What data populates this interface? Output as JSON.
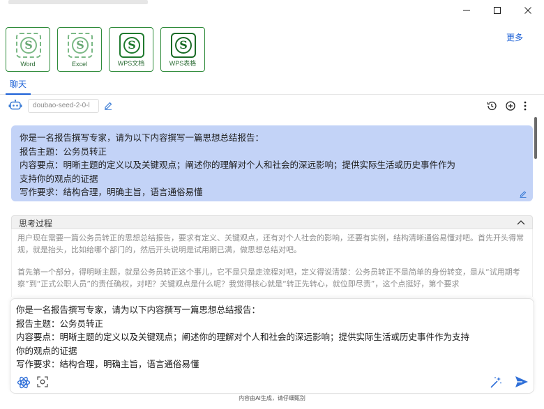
{
  "window": {
    "controls": {
      "minimize_icon": "minimize-icon",
      "maximize_icon": "maximize-icon",
      "close_icon": "close-icon"
    }
  },
  "apps": {
    "tiles": [
      {
        "label": "Word",
        "glyph": "S"
      },
      {
        "label": "Excel",
        "glyph": "S"
      },
      {
        "label": "WPS文档",
        "glyph": "S"
      },
      {
        "label": "WPS表格",
        "glyph": "S"
      }
    ],
    "more_label": "更多"
  },
  "tabs": {
    "chat_label": "聊天"
  },
  "model_bar": {
    "model_name": "doubao-seed-2-0-l",
    "icons": [
      "robot-icon",
      "edit-icon",
      "history-icon",
      "new-chat-icon",
      "more-vertical-icon"
    ]
  },
  "conversation": {
    "user_message": {
      "lines": [
        "你是一名报告撰写专家，请为以下内容撰写一篇思想总结报告：",
        "报告主题：公务员转正",
        "内容要点：明晰主题的定义以及关键观点；阐述你的理解对个人和社会的深远影响；提供实际生活或历史事件作为",
        "支持你的观点的证据",
        "写作要求：结构合理，明确主旨，语言通俗易懂"
      ]
    },
    "thinking": {
      "title": "思考过程",
      "paragraphs": [
        "用户现在需要一篇公务员转正的思想总结报告，要求有定义、关键观点，还有对个人社会的影响，还要有实例，结构清晰通俗易懂对吧。首先开头得常规，就是抬头，比如给哪个部门的，然后开头说明是试用期已满，做思想总结对吧。",
        "首先第一个部分，得明晰主题，就是公务员转正这个事儿，它不是只是走流程对吧，定义得说清楚：公务员转正不是简单的身份转变，是从“试用期考察”到“正式公职人员”的责任确权，对吧？关键观点是什么呢？我觉得核心就是“转正先转心，就位即尽责”，这个点挺好，第个要求"
      ]
    }
  },
  "input": {
    "lines": [
      "你是一名报告撰写专家，请为以下内容撰写一篇思想总结报告：",
      "报告主题：公务员转正",
      "内容要点：明晰主题的定义以及关键观点；阐述你的理解对个人和社会的深远影响；提供实际生活或历史事件作为支持",
      "你的观点的证据",
      "写作要求：结构合理，明确主旨，语言通俗易懂"
    ],
    "icons": [
      "atom-icon",
      "screen-capture-icon",
      "magic-wand-icon",
      "send-icon"
    ]
  },
  "footer": {
    "note": "内容由AI生成，请仔细甄别"
  },
  "colors": {
    "accent": "#1a5fd6",
    "user_bubble": "#c3d3f7",
    "wps_green": "#1f7a2e"
  }
}
